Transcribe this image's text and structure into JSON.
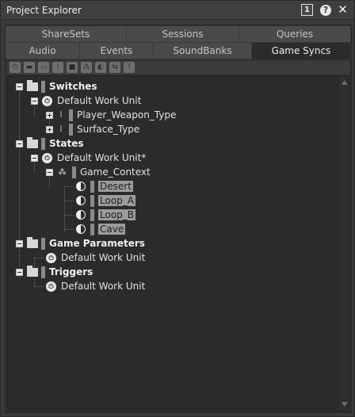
{
  "window": {
    "title": "Project Explorer",
    "btn_one": "1",
    "btn_help": "?",
    "btn_close": "✕"
  },
  "tabs": {
    "row1": [
      "ShareSets",
      "Sessions",
      "Queries"
    ],
    "row2": [
      "Audio",
      "Events",
      "SoundBanks",
      "Game Syncs"
    ],
    "active": "Game Syncs"
  },
  "toolbar": [
    "power-icon",
    "folder-icon",
    "workunit-folder-icon",
    "switch-group-icon",
    "switch-icon",
    "state-group-icon",
    "state-icon",
    "game-parameter-icon",
    "trigger-icon"
  ],
  "tree": {
    "switches": {
      "label": "Switches",
      "wu": "Default Work Unit",
      "items": [
        "Player_Weapon_Type",
        "Surface_Type"
      ]
    },
    "states": {
      "label": "States",
      "wu": "Default Work Unit*",
      "group": "Game_Context",
      "items": [
        "Desert",
        "Loop_A",
        "Loop_B",
        "Cave"
      ]
    },
    "game_parameters": {
      "label": "Game Parameters",
      "wu": "Default Work Unit"
    },
    "triggers": {
      "label": "Triggers",
      "wu": "Default Work Unit"
    }
  }
}
